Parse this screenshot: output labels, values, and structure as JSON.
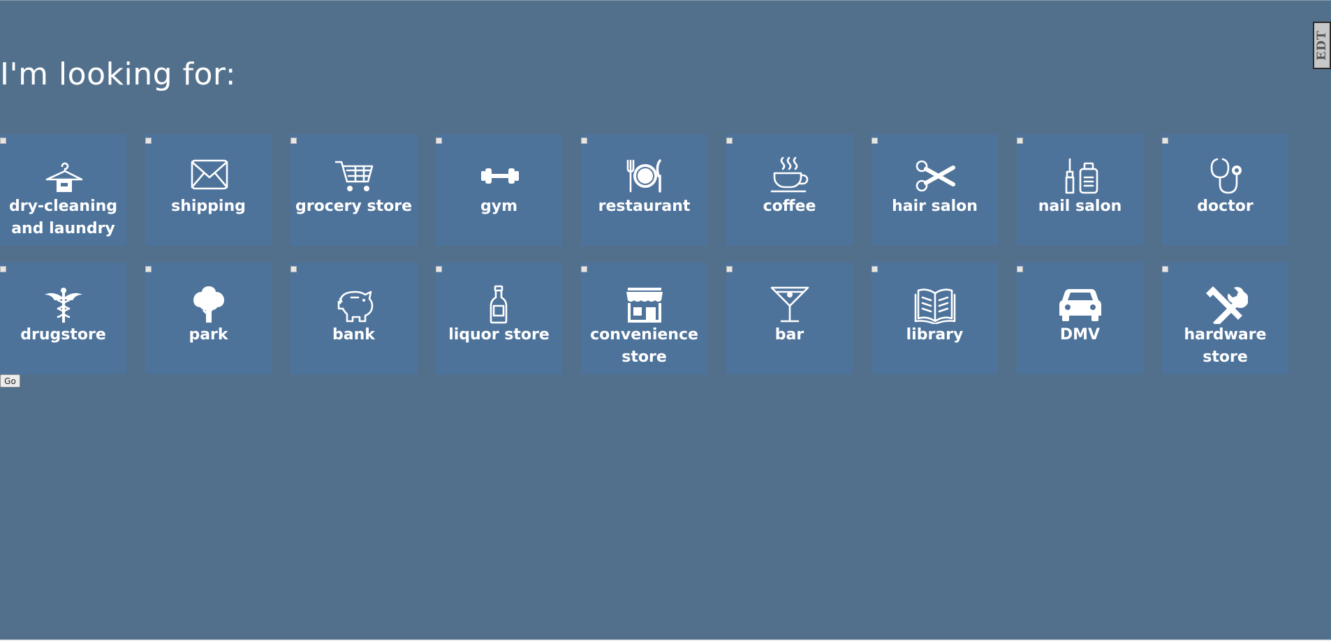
{
  "page": {
    "title": "I'm looking for:",
    "go_label": "Go",
    "side_tab_label": "EDT"
  },
  "colors": {
    "background": "#52708c",
    "tile": "#4e739b",
    "text": "#ffffff"
  },
  "categories": [
    [
      {
        "label": "dry-cleaning and laundry",
        "icon": "hanger-icon",
        "checked": false
      },
      {
        "label": "shipping",
        "icon": "envelope-icon",
        "checked": false
      },
      {
        "label": "grocery store",
        "icon": "shopping-cart-icon",
        "checked": false
      },
      {
        "label": "gym",
        "icon": "dumbbell-icon",
        "checked": false
      },
      {
        "label": "restaurant",
        "icon": "plate-cutlery-icon",
        "checked": false
      },
      {
        "label": "coffee",
        "icon": "coffee-cup-icon",
        "checked": false
      },
      {
        "label": "hair salon",
        "icon": "scissors-icon",
        "checked": false
      },
      {
        "label": "nail salon",
        "icon": "nail-polish-icon",
        "checked": false
      },
      {
        "label": "doctor",
        "icon": "stethoscope-icon",
        "checked": false
      }
    ],
    [
      {
        "label": "drugstore",
        "icon": "caduceus-icon",
        "checked": false
      },
      {
        "label": "park",
        "icon": "tree-icon",
        "checked": false
      },
      {
        "label": "bank",
        "icon": "piggy-bank-icon",
        "checked": false
      },
      {
        "label": "liquor store",
        "icon": "bottle-icon",
        "checked": false
      },
      {
        "label": "convenience store",
        "icon": "storefront-icon",
        "checked": false
      },
      {
        "label": "bar",
        "icon": "cocktail-icon",
        "checked": false
      },
      {
        "label": "library",
        "icon": "open-book-icon",
        "checked": false
      },
      {
        "label": "DMV",
        "icon": "car-icon",
        "checked": false
      },
      {
        "label": "hardware store",
        "icon": "tools-icon",
        "checked": false
      }
    ]
  ]
}
